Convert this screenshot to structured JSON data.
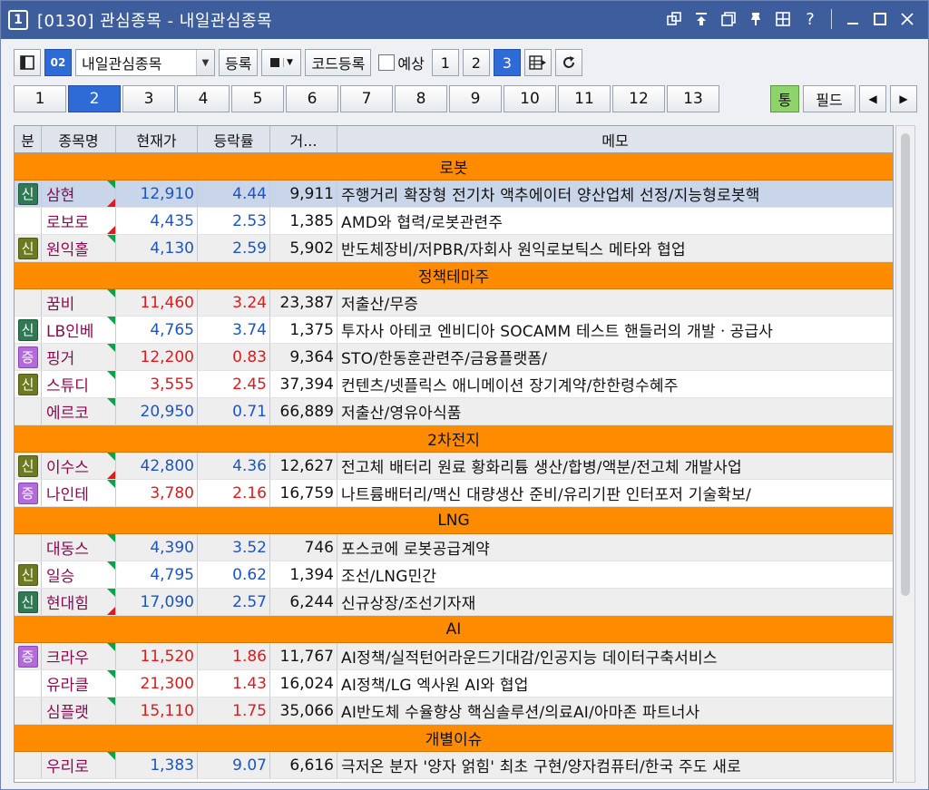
{
  "titlebar": {
    "window_number": "1",
    "title": "[0130] 관심종목 - 내일관심종목",
    "icons": [
      "restore-link-icon",
      "pin-top-icon",
      "copy-window-icon",
      "pushpin-icon",
      "grid-icon",
      "help-icon",
      "minimize-icon",
      "maximize-icon",
      "close-icon"
    ]
  },
  "toolbar": {
    "group_number": "02",
    "group_select": "내일관심종목",
    "register_label": "등록",
    "code_register_label": "코드등록",
    "expect_label": "예상",
    "pages": [
      "1",
      "2",
      "3"
    ],
    "active_page": "3"
  },
  "tabs": {
    "items": [
      "1",
      "2",
      "3",
      "4",
      "5",
      "6",
      "7",
      "8",
      "9",
      "10",
      "11",
      "12",
      "13"
    ],
    "active": "2",
    "tong_label": "통",
    "field_label": "필드"
  },
  "grid": {
    "headers": {
      "flag": "분",
      "name": "종목명",
      "price": "현재가",
      "rate": "등락률",
      "volume": "거...",
      "memo": "메모"
    },
    "groups": [
      {
        "title": "로봇",
        "rows": [
          {
            "flag": "신",
            "name": "삼현",
            "price": "12,910",
            "rate": "4.44",
            "volume": "9,911",
            "memo": "주행거리 확장형 전기차 액추에이터 양산업체 선정/지능형로봇핵"
          },
          {
            "flag": "",
            "name": "로보로",
            "price": "4,435",
            "rate": "2.53",
            "volume": "1,385",
            "memo": "AMD와 협력/로봇관련주"
          },
          {
            "flag": "신",
            "name": "원익홀",
            "price": "4,130",
            "rate": "2.59",
            "volume": "5,902",
            "memo": "반도체장비/저PBR/자회사 원익로보틱스 메타와 협업"
          }
        ]
      },
      {
        "title": "정책테마주",
        "rows": [
          {
            "flag": "",
            "name": "꿈비",
            "price": "11,460",
            "rate": "3.24",
            "volume": "23,387",
            "memo": "저출산/무증"
          },
          {
            "flag": "신",
            "name": "LB인베",
            "price": "4,765",
            "rate": "3.74",
            "volume": "1,375",
            "memo": "투자사 아테코 엔비디아 SOCAMM 테스트 핸들러의 개발ㆍ공급사"
          },
          {
            "flag": "증",
            "name": "핑거",
            "price": "12,200",
            "rate": "0.83",
            "volume": "9,364",
            "memo": "STO/한동훈관련주/금융플랫폼/"
          },
          {
            "flag": "신",
            "name": "스튜디",
            "price": "3,555",
            "rate": "2.45",
            "volume": "37,394",
            "memo": "컨텐츠/넷플릭스 애니메이션 장기계약/한한령수혜주"
          },
          {
            "flag": "",
            "name": "에르코",
            "price": "20,950",
            "rate": "0.71",
            "volume": "66,889",
            "memo": "저출산/영유아식품"
          }
        ]
      },
      {
        "title": "2차전지",
        "rows": [
          {
            "flag": "신",
            "name": "이수스",
            "price": "42,800",
            "rate": "4.36",
            "volume": "12,627",
            "memo": "전고체 배터리 원료 황화리튬 생산/합병/액분/전고체 개발사업"
          },
          {
            "flag": "증",
            "name": "나인테",
            "price": "3,780",
            "rate": "2.16",
            "volume": "16,759",
            "memo": "나트륨배터리/맥신 대량생산 준비/유리기판 인터포저 기술확보/"
          }
        ]
      },
      {
        "title": "LNG",
        "rows": [
          {
            "flag": "",
            "name": "대동스",
            "price": "4,390",
            "rate": "3.52",
            "volume": "746",
            "memo": "포스코에 로봇공급계약"
          },
          {
            "flag": "신",
            "name": "일승",
            "price": "4,795",
            "rate": "0.62",
            "volume": "1,394",
            "memo": "조선/LNG민간"
          },
          {
            "flag": "신",
            "name": "현대힘",
            "price": "17,090",
            "rate": "2.57",
            "volume": "6,244",
            "memo": "신규상장/조선기자재"
          }
        ]
      },
      {
        "title": "AI",
        "rows": [
          {
            "flag": "증",
            "name": "크라우",
            "price": "11,520",
            "rate": "1.86",
            "volume": "11,767",
            "memo": "AI정책/실적턴어라운드기대감/인공지능 데이터구축서비스"
          },
          {
            "flag": "",
            "name": "유라클",
            "price": "21,300",
            "rate": "1.43",
            "volume": "16,024",
            "memo": "AI정책/LG 엑사원 AI와 협업"
          },
          {
            "flag": "",
            "name": "심플랫",
            "price": "15,110",
            "rate": "1.75",
            "volume": "35,066",
            "memo": "AI반도체 수율향상 핵심솔루션/의료AI/아마존 파트너사"
          }
        ]
      },
      {
        "title": "개별이슈",
        "rows": [
          {
            "flag": "",
            "name": "우리로",
            "price": "1,383",
            "rate": "9.07",
            "volume": "6,616",
            "memo": "극저온 분자 '양자 얽힘' 최초 구현/양자컴퓨터/한국 주도 새로"
          }
        ]
      }
    ]
  },
  "row_styles": [
    {
      "dir": "dn",
      "badge": "badge-new",
      "tri": "gr",
      "sel": true
    },
    {
      "dir": "dn",
      "badge": "",
      "tri": "r"
    },
    {
      "dir": "dn",
      "badge": "badge-new2",
      "tri": "g"
    },
    {
      "dir": "up",
      "badge": "",
      "tri": "g"
    },
    {
      "dir": "dn",
      "badge": "badge-new",
      "tri": "g"
    },
    {
      "dir": "up",
      "badge": "badge-inc",
      "tri": "g"
    },
    {
      "dir": "up",
      "badge": "badge-new2",
      "tri": "g"
    },
    {
      "dir": "dn",
      "badge": "",
      "tri": "g"
    },
    {
      "dir": "dn",
      "badge": "badge-new2",
      "tri": "gr"
    },
    {
      "dir": "up",
      "badge": "badge-inc",
      "tri": "g"
    },
    {
      "dir": "dn",
      "badge": "",
      "tri": "g"
    },
    {
      "dir": "dn",
      "badge": "badge-new2",
      "tri": "g"
    },
    {
      "dir": "dn",
      "badge": "badge-new",
      "tri": "gr"
    },
    {
      "dir": "up",
      "badge": "badge-inc",
      "tri": "g"
    },
    {
      "dir": "up",
      "badge": "",
      "tri": "g"
    },
    {
      "dir": "up",
      "badge": "",
      "tri": "g"
    },
    {
      "dir": "dn",
      "badge": "",
      "tri": "g"
    }
  ],
  "colors": {
    "titlebar": "#3e5d9c",
    "group_header": "#ff8c00",
    "up": "#e0191c",
    "down": "#1a55c6",
    "selected_row": "#c9d6ea",
    "active_tab": "#2f6bd6"
  }
}
